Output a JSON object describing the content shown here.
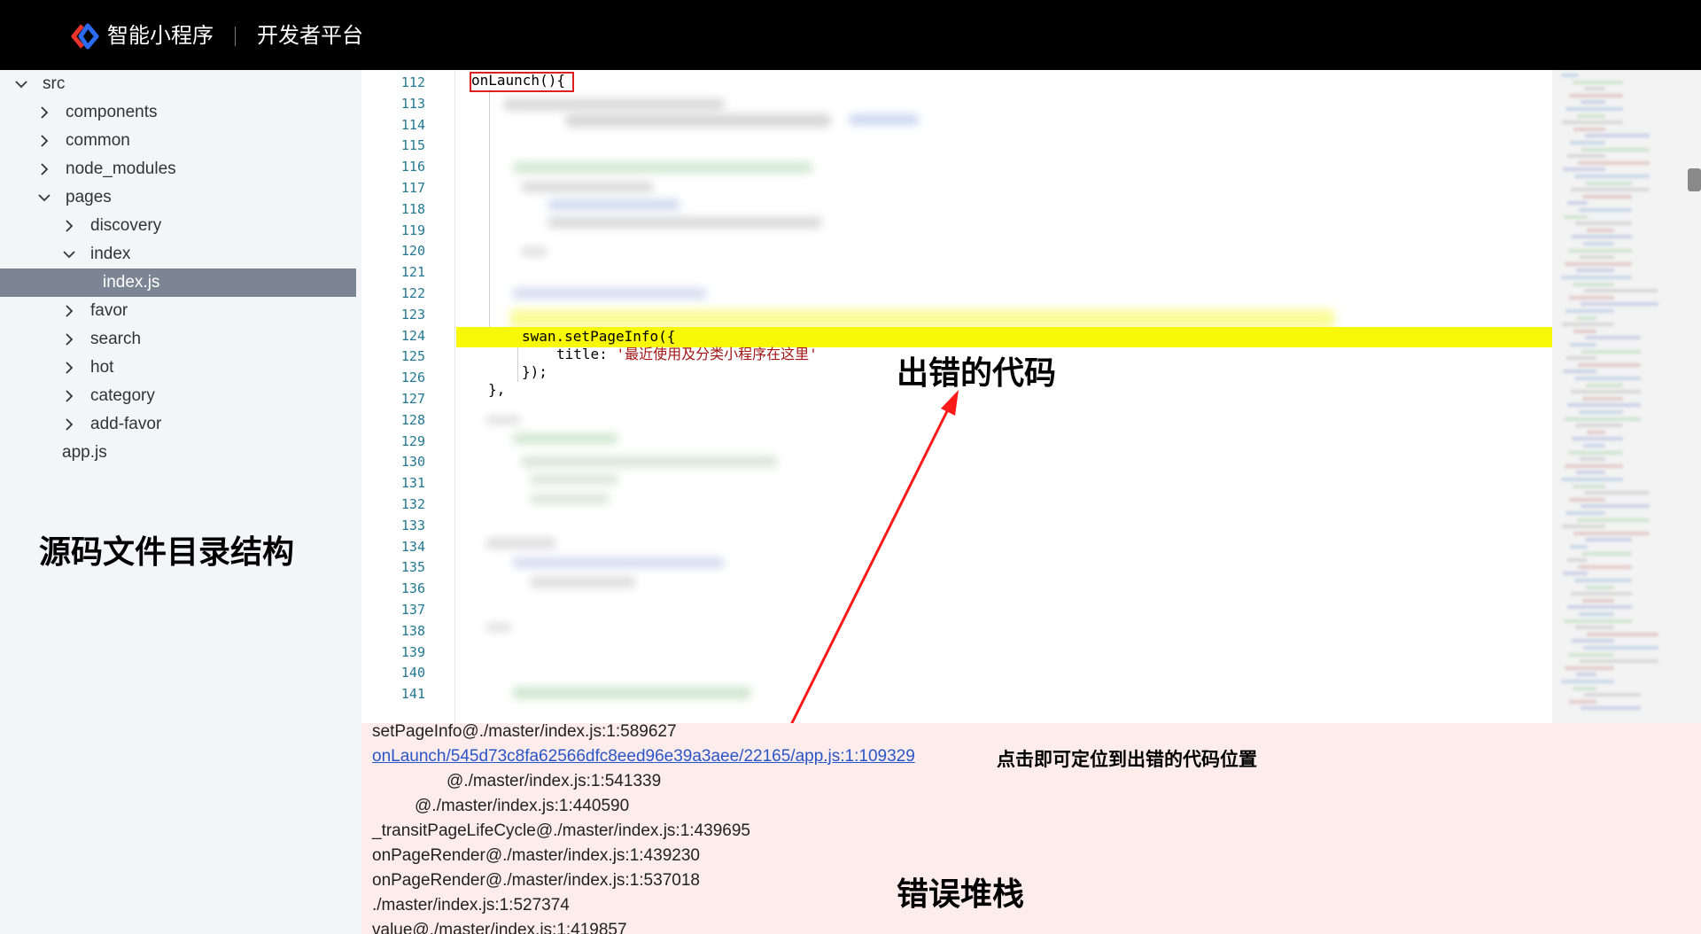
{
  "header": {
    "brand": "智能小程序",
    "platform": "开发者平台"
  },
  "sidebar": {
    "items": [
      {
        "label": "src",
        "expanded": true,
        "has_arrow": true
      },
      {
        "label": "components",
        "expanded": false,
        "has_arrow": true
      },
      {
        "label": "common",
        "expanded": false,
        "has_arrow": true
      },
      {
        "label": "node_modules",
        "expanded": false,
        "has_arrow": true
      },
      {
        "label": "pages",
        "expanded": true,
        "has_arrow": true
      },
      {
        "label": "discovery",
        "expanded": false,
        "has_arrow": true
      },
      {
        "label": "index",
        "expanded": true,
        "has_arrow": true
      },
      {
        "label": "index.js",
        "selected": true,
        "has_arrow": false
      },
      {
        "label": "favor",
        "expanded": false,
        "has_arrow": true
      },
      {
        "label": "search",
        "expanded": false,
        "has_arrow": true
      },
      {
        "label": "hot",
        "expanded": false,
        "has_arrow": true
      },
      {
        "label": "category",
        "expanded": false,
        "has_arrow": true
      },
      {
        "label": "add-favor",
        "expanded": false,
        "has_arrow": true
      },
      {
        "label": "app.js",
        "has_arrow": false
      }
    ],
    "caption": "源码文件目录结构"
  },
  "editor": {
    "line_numbers": [
      "112",
      "113",
      "114",
      "115",
      "116",
      "117",
      "118",
      "119",
      "120",
      "121",
      "122",
      "123",
      "124",
      "125",
      "126",
      "127",
      "128",
      "129",
      "130",
      "131",
      "132",
      "133",
      "134",
      "135",
      "136",
      "137",
      "138",
      "139",
      "140",
      "141"
    ],
    "code_line_112": "onLaunch(){",
    "code_line_124": "swan.setPageInfo({",
    "code_line_125_key": "title: ",
    "code_line_125_value": "'最近使用及分类小程序在这里'",
    "code_line_126": "});",
    "code_line_127": "},",
    "highlight_color": "#f7f708",
    "caption": "出错的代码"
  },
  "stack": {
    "lines": [
      "setPageInfo@./master/index.js:1:589627",
      "onLaunch/545d73c8fa62566dfc8eed96e39a3aee/22165/app.js:1:109329",
      "@./master/index.js:1:541339",
      "@./master/index.js:1:440590",
      "_transitPageLifeCycle@./master/index.js:1:439695",
      "onPageRender@./master/index.js:1:439230",
      "onPageRender@./master/index.js:1:537018",
      "./master/index.js:1:527374",
      "value@./master/index.js:1:419857"
    ],
    "note": "点击即可定位到出错的代码位置",
    "caption": "错误堆栈",
    "background": "#fdecec"
  },
  "colors": {
    "accent_red": "#e02020",
    "link_blue": "#2a55c9",
    "logo_red": "#e8342b",
    "logo_blue": "#2a6bf2"
  }
}
